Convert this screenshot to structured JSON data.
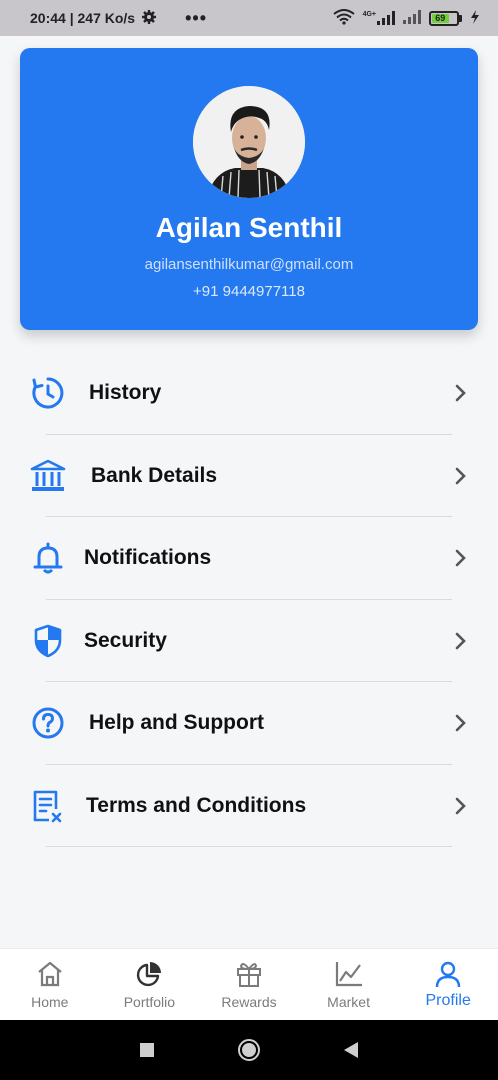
{
  "status_bar": {
    "time_speed": "20:44 | 247 Ko/s",
    "dots": "•••",
    "network_label": "4G+",
    "battery_level": "69",
    "battery_percent": 69
  },
  "profile": {
    "name": "Agilan Senthil",
    "email": "agilansenthilkumar@gmail.com",
    "phone": "+91 9444977118"
  },
  "menu": {
    "items": [
      {
        "label": "History",
        "icon": "clock-history-icon"
      },
      {
        "label": "Bank Details",
        "icon": "bank-icon"
      },
      {
        "label": "Notifications",
        "icon": "bell-icon"
      },
      {
        "label": "Security",
        "icon": "shield-icon"
      },
      {
        "label": "Help and Support",
        "icon": "help-circle-icon"
      },
      {
        "label": "Terms and Conditions",
        "icon": "document-icon"
      }
    ]
  },
  "bottom_nav": {
    "items": [
      {
        "label": "Home",
        "icon": "home-icon"
      },
      {
        "label": "Portfolio",
        "icon": "pie-chart-icon"
      },
      {
        "label": "Rewards",
        "icon": "gift-icon"
      },
      {
        "label": "Market",
        "icon": "line-chart-icon"
      },
      {
        "label": "Profile",
        "icon": "user-icon"
      }
    ],
    "active": "Profile"
  },
  "colors": {
    "accent": "#2478f0",
    "inactive": "#7b7b7b"
  }
}
